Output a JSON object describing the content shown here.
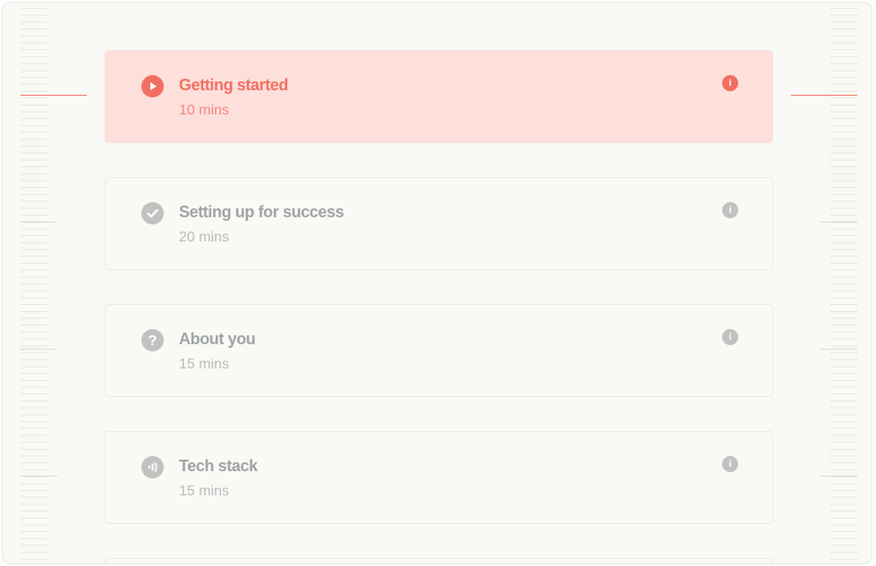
{
  "colors": {
    "accent": "#f26e60",
    "active_bg": "#fde0dc",
    "muted_icon": "#c0c2c0",
    "muted_title": "#9ea3a3",
    "muted_text": "#b7bab9",
    "frame_bg": "#f9f9f5"
  },
  "steps": [
    {
      "title": "Getting started",
      "duration": "10 mins",
      "icon": "play-icon",
      "state": "active"
    },
    {
      "title": "Setting up for success",
      "duration": "20 mins",
      "icon": "check-circle-icon",
      "state": "completed"
    },
    {
      "title": "About you",
      "duration": "15 mins",
      "icon": "question-circle-icon",
      "state": "pending"
    },
    {
      "title": "Tech stack",
      "duration": "15 mins",
      "icon": "signal-waves-icon",
      "state": "pending"
    }
  ],
  "info_glyph": "i"
}
